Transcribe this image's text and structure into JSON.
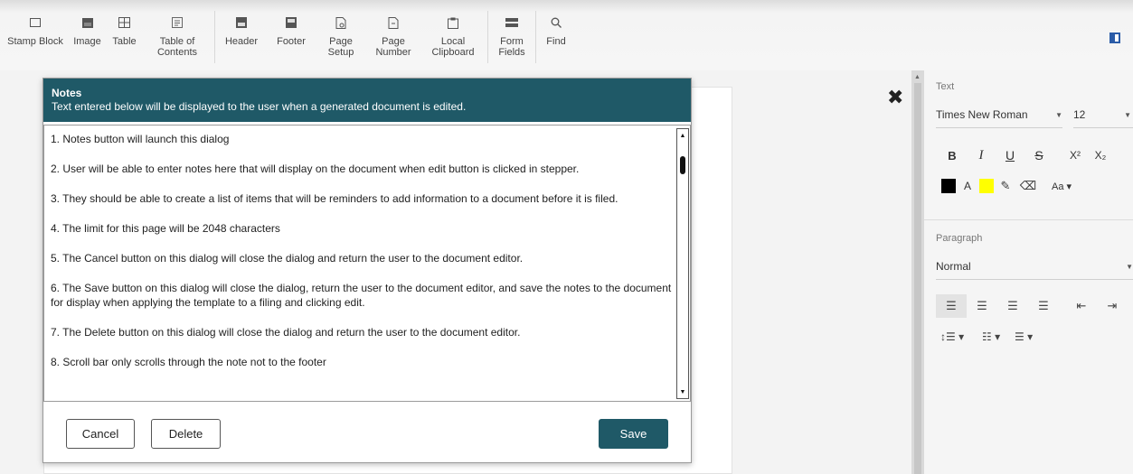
{
  "toolbar": {
    "items": [
      {
        "label": "Stamp Block",
        "icon": "stamp-block-icon"
      },
      {
        "label": "Image",
        "icon": "image-icon"
      },
      {
        "label": "Table",
        "icon": "table-icon"
      },
      {
        "label": "Table of Contents",
        "icon": "toc-icon"
      },
      {
        "label": "Header",
        "icon": "header-icon"
      },
      {
        "label": "Footer",
        "icon": "footer-icon"
      },
      {
        "label": "Page Setup",
        "icon": "page-setup-icon"
      },
      {
        "label": "Page Number",
        "icon": "page-number-icon"
      },
      {
        "label": "Local Clipboard",
        "icon": "clipboard-icon"
      },
      {
        "label": "Form Fields",
        "icon": "form-fields-icon"
      },
      {
        "label": "Find",
        "icon": "search-icon"
      }
    ]
  },
  "dialog": {
    "title": "Notes",
    "subtitle": "Text entered below will be displayed to the user when a generated document is edited.",
    "notes": [
      "1. Notes button will launch this dialog",
      "2. User will be able to enter notes here that will display on the document when edit button is clicked in stepper.",
      "3. They should be able to create a list of items that will be reminders to add information to a document before it is filed.",
      "4. The limit for this page will be 2048 characters",
      "5. The Cancel button on this dialog will close the dialog and return the user to the document editor.",
      "6. The Save button on this dialog will close the dialog, return the user to the document editor, and save the notes to the document for display when applying the template to a filing and clicking edit.",
      "7. The Delete button on this dialog will close the dialog and return the user to the document editor.",
      "8. Scroll bar only scrolls through the note not to the footer"
    ],
    "cancel_label": "Cancel",
    "delete_label": "Delete",
    "save_label": "Save"
  },
  "close_glyph": "✖",
  "right_panel": {
    "text_section_label": "Text",
    "font_family": "Times New Roman",
    "font_size": "12",
    "bold": "B",
    "italic": "I",
    "underline": "U",
    "strike": "S",
    "superscript": "X²",
    "subscript": "X₂",
    "font_color_label": "A",
    "case_label": "Aa ▾",
    "paragraph_section_label": "Paragraph",
    "paragraph_style": "Normal",
    "colors": {
      "font": "#000000",
      "highlight": "#ffff00",
      "accent": "#1f5967"
    }
  }
}
